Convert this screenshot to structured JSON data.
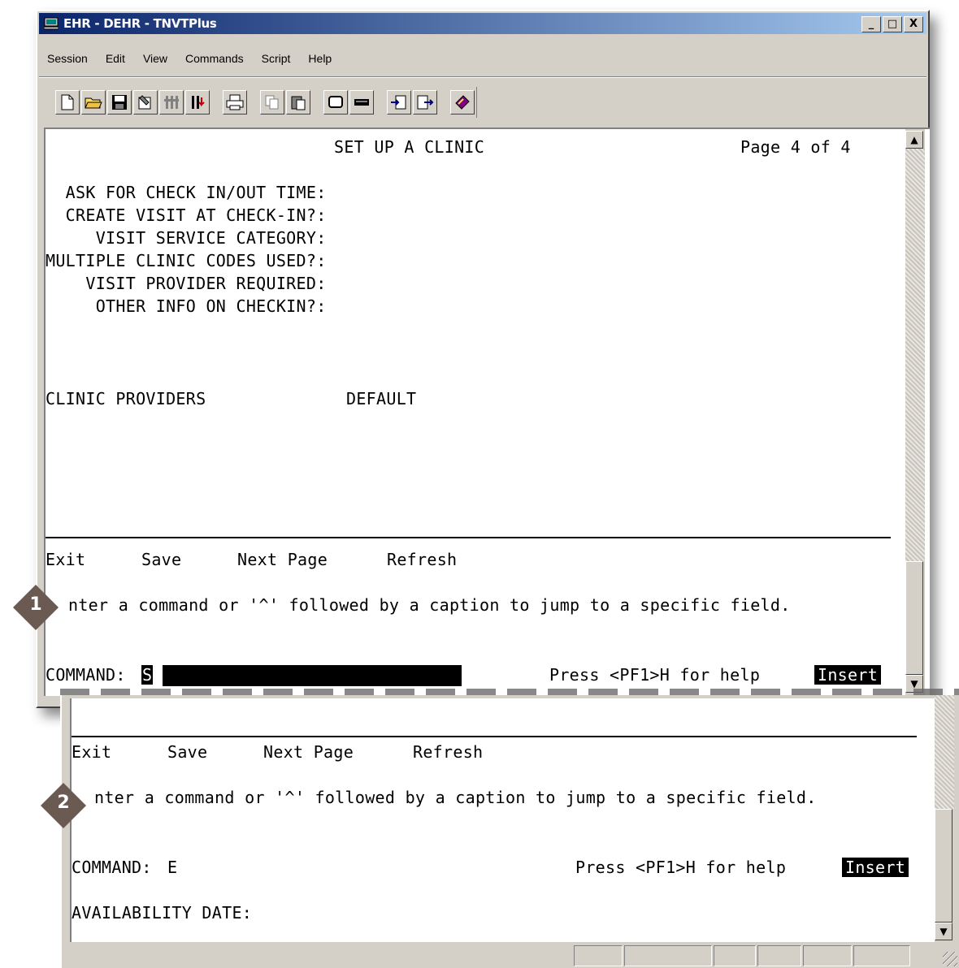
{
  "window": {
    "title": "EHR - DEHR - TNVTPlus",
    "controls": [
      "_",
      "□",
      "X"
    ]
  },
  "menu": [
    "Session",
    "Edit",
    "View",
    "Commands",
    "Script",
    "Help"
  ],
  "toolbar_icons": [
    "new-file-icon",
    "open-folder-icon",
    "save-icon",
    "properties-icon",
    "connect-icon",
    "disconnect-icon",
    "print-icon",
    "copy-icon",
    "paste-icon",
    "screen-icon",
    "keyboard-icon",
    "send-file-icon",
    "receive-file-icon",
    "help-book-icon"
  ],
  "screen1": {
    "heading": "SET UP A CLINIC",
    "page": "Page 4 of 4",
    "fields": [
      "  ASK FOR CHECK IN/OUT TIME:",
      "  CREATE VISIT AT CHECK-IN?:",
      "     VISIT SERVICE CATEGORY:",
      "MULTIPLE CLINIC CODES USED?:",
      "    VISIT PROVIDER REQUIRED:",
      "     OTHER INFO ON CHECKIN?:"
    ],
    "providers_label": "CLINIC PROVIDERS",
    "default_label": "DEFAULT",
    "actions": [
      "Exit",
      "Save",
      "Next Page",
      "Refresh"
    ],
    "instruction": "nter a command or '^' followed by a caption to jump to a specific field.",
    "command_label": "COMMAND:",
    "command_value": "S",
    "help": "Press <PF1>H for help",
    "mode": "Insert"
  },
  "screen2": {
    "actions": [
      "Exit",
      "Save",
      "Next Page",
      "Refresh"
    ],
    "instruction": "nter a command or '^' followed by a caption to jump to a specific field.",
    "command_label": "COMMAND:",
    "command_value": "E",
    "help": "Press <PF1>H for help",
    "mode": "Insert",
    "next_field": "AVAILABILITY DATE:"
  },
  "callouts": [
    "1",
    "2"
  ],
  "colors": {
    "titlebar_start": "#0a246a",
    "titlebar_end": "#a6caf0",
    "callout": "#6b5a52",
    "chrome": "#d4d0c8"
  }
}
